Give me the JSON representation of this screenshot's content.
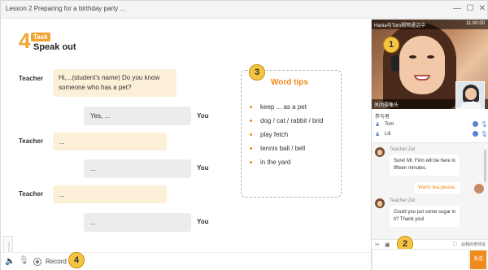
{
  "window": {
    "title": "Lesson 2  Preparing for a birthday party ...",
    "controls": {
      "minimize": "—",
      "maximize": "☐",
      "close": "✕"
    }
  },
  "task": {
    "number": "4",
    "tag": "Task",
    "subtitle": "Speak out"
  },
  "dialogue": [
    {
      "speaker": "Teacher",
      "text_line1": "Hi,...(student's name) Do you know",
      "text_line2": "someone who has a pet?"
    },
    {
      "speaker": "You",
      "text": "Yes, ..."
    },
    {
      "speaker": "Teacher",
      "text": "..."
    },
    {
      "speaker": "You",
      "text": "..."
    },
    {
      "speaker": "Teacher",
      "text": "..."
    },
    {
      "speaker": "You",
      "text": "..."
    }
  ],
  "word_tips": {
    "title": "Word tips",
    "items": [
      "keep ... as a pet",
      "dog / cat / rabbit / brid",
      "play fetch",
      "tennis ball / bell",
      "in the yard"
    ]
  },
  "badges": [
    "1",
    "2",
    "3",
    "4"
  ],
  "bottom_bar": {
    "speaker_icon": "speaker-icon",
    "mic_icon": "microphone-icon",
    "record_label": "Record",
    "volume_level": 0.55
  },
  "video": {
    "title": "Hania与Tom视频通话中",
    "time": "11:00:00",
    "bottom_label": "关闭摄像头"
  },
  "participants": {
    "label": "参与者",
    "list": [
      {
        "name": "Tom"
      },
      {
        "name": "Lili"
      }
    ]
  },
  "chat": {
    "messages": [
      {
        "from": "Teacher:Zel",
        "line1": "Sure! Mr. Finn will be here in",
        "line2": "fifteen minutes."
      },
      {
        "from": "self",
        "text": "Warm tea,please."
      },
      {
        "from": "Teacher:Zel",
        "line1": "Could you put some sugar in",
        "line2": "it? Thank you!"
      }
    ],
    "tool_text": "@我的老师说",
    "send_label": "发送"
  },
  "colors": {
    "accent": "#f2a532",
    "tips_title": "#f08a1c",
    "teacher_bubble": "#fdf0d9",
    "you_bubble": "#ececec",
    "send": "#f08a1c"
  }
}
